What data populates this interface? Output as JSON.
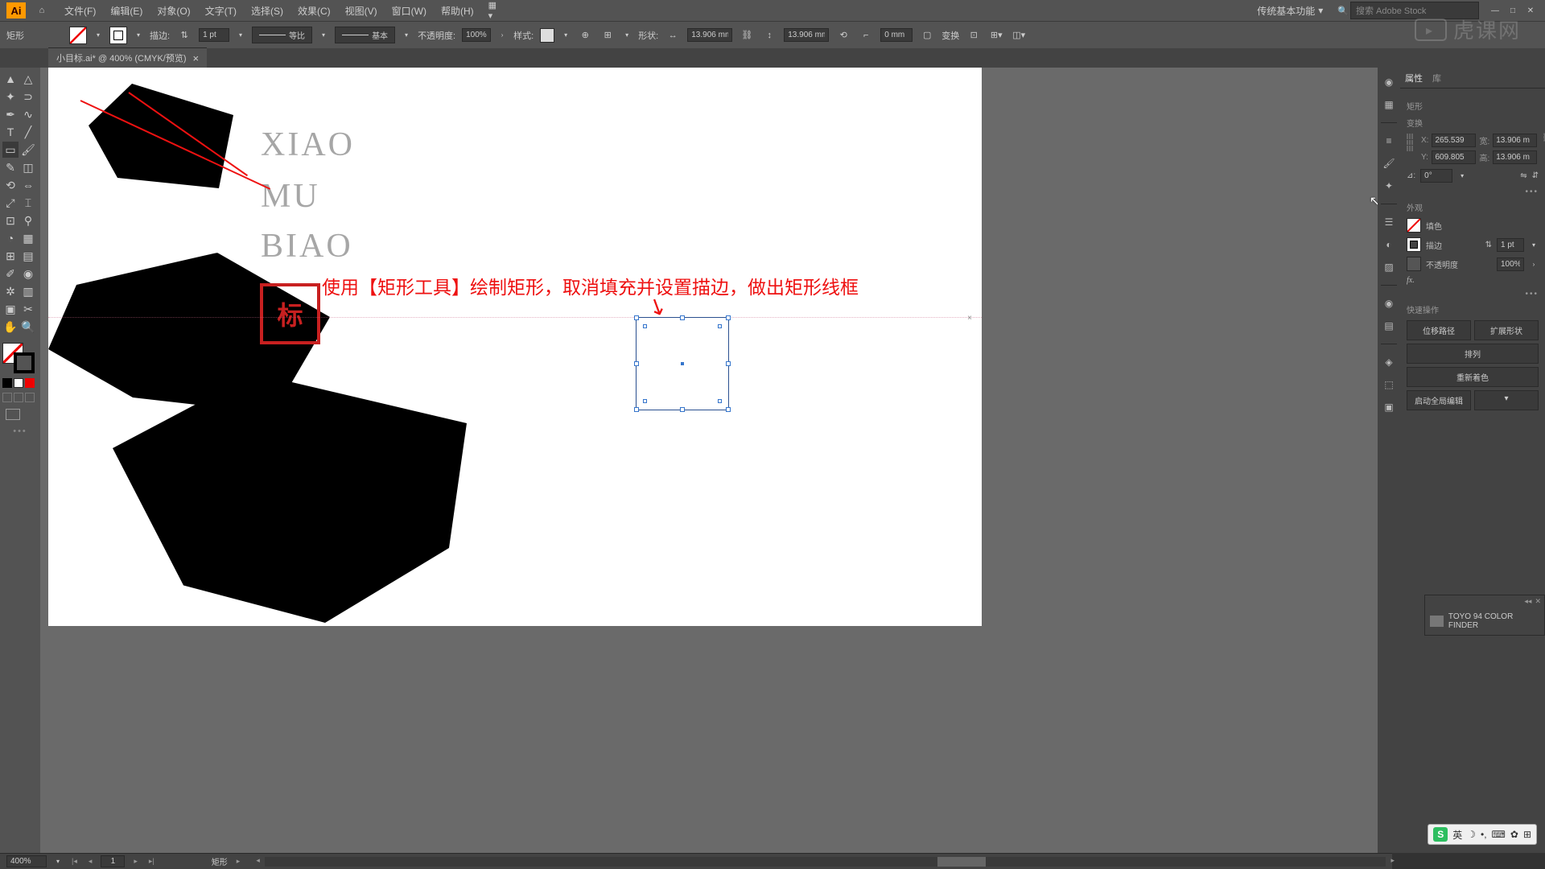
{
  "menubar": {
    "items": [
      "文件(F)",
      "编辑(E)",
      "对象(O)",
      "文字(T)",
      "选择(S)",
      "效果(C)",
      "视图(V)",
      "窗口(W)",
      "帮助(H)"
    ],
    "workspace": "传统基本功能",
    "search_placeholder": "搜索 Adobe Stock"
  },
  "options_bar": {
    "tool_label": "矩形",
    "stroke_label": "描边:",
    "stroke_weight": "1 pt",
    "profile1": "等比",
    "profile2": "基本",
    "opacity_label": "不透明度:",
    "opacity": "100%",
    "style_label": "样式:",
    "shape_label": "形状:",
    "width_val": "13.906 mm",
    "height_val": "13.906 mm",
    "corner_val": "0 mm",
    "transform_label": "变换"
  },
  "doc_tab": {
    "title": "小目标.ai* @ 400% (CMYK/预览)"
  },
  "canvas": {
    "text1": "XIAO",
    "text2": "MU",
    "text3": "BIAO",
    "stamp": "标",
    "annotation": "使用【矩形工具】绘制矩形，取消填充并设置描边，做出矩形线框",
    "guide_marker": "×"
  },
  "properties": {
    "tab1": "属性",
    "tab2": "库",
    "shape_type": "矩形",
    "section_transform": "变换",
    "x_lbl": "X:",
    "x": "265.539",
    "y_lbl": "Y:",
    "y": "609.805",
    "w_lbl": "宽:",
    "w": "13.906 m",
    "h_lbl": "高:",
    "h": "13.906 m",
    "angle_lbl": "⊿:",
    "angle": "0°",
    "section_appearance": "外观",
    "fill_label": "填色",
    "stroke_label": "描边",
    "stroke_weight": "1 pt",
    "opacity_label": "不透明度",
    "opacity": "100%",
    "fx": "fx.",
    "section_quick": "快速操作",
    "btn_offset": "位移路径",
    "btn_expand": "扩展形状",
    "btn_arrange": "排列",
    "btn_recolor": "重新着色",
    "btn_global_edit": "启动全局编辑"
  },
  "color_panel": {
    "title": "TOYO 94 COLOR FINDER"
  },
  "status_bar": {
    "zoom": "400%",
    "page": "1",
    "tool": "矩形"
  },
  "ime": {
    "lang": "英",
    "logo": "S"
  },
  "watermark": "虎课网"
}
